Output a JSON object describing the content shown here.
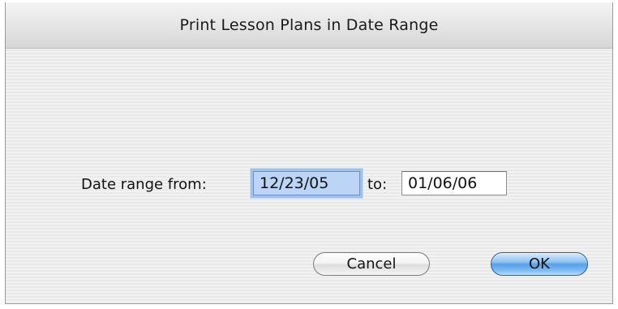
{
  "dialog": {
    "title": "Print Lesson Plans in Date Range"
  },
  "range": {
    "from_label": "Date range from:",
    "from_value": "12/23/05",
    "to_label": "to:",
    "to_value": "01/06/06"
  },
  "buttons": {
    "cancel_label": "Cancel",
    "ok_label": "OK"
  },
  "colors": {
    "focus_highlight": "#bcd5f6",
    "default_button": "#5aa0e6"
  }
}
